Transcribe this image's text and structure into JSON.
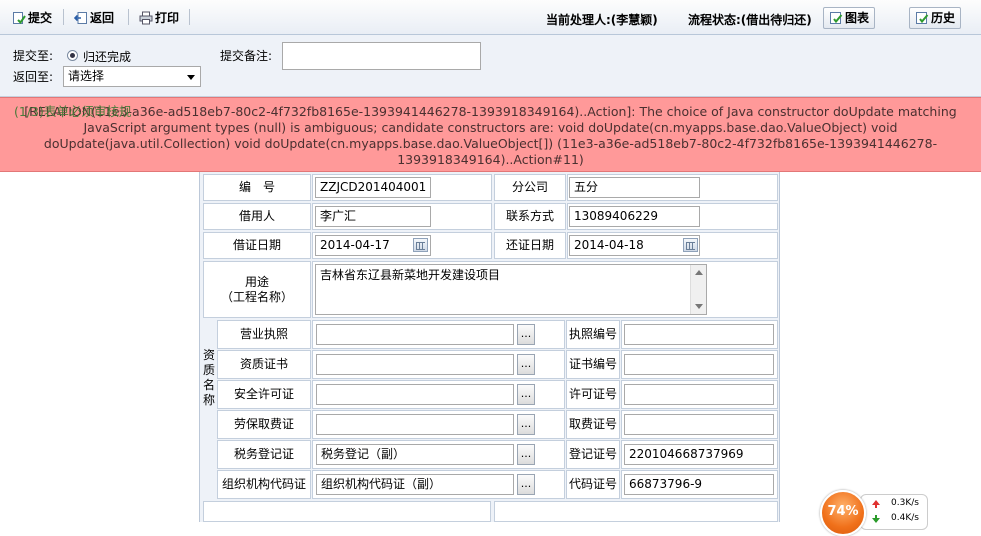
{
  "toolbar": {
    "submit_label": "提交",
    "back_label": "返回",
    "print_label": "打印",
    "handler_text": "当前处理人:(李慧颖)",
    "status_text": "流程状态:(借出待归还)",
    "chart_label": "图表",
    "history_label": "历史"
  },
  "submit_panel": {
    "submit_to_label": "提交至:",
    "radio_option": "归还完成",
    "return_to_label": "返回至:",
    "return_select_value": "请选择",
    "remark_label": "提交备注:",
    "remark_value": ""
  },
  "error": {
    "overlay_text": "(1/3)表单必须审核规",
    "message": "[RELATION(11e3-a36e-ad518eb7-80c2-4f732fb8165e-1393941446278-1393918349164)..Action]: The choice of Java constructor doUpdate matching JavaScript argument types (null) is ambiguous; candidate constructors are: void doUpdate(cn.myapps.base.dao.ValueObject) void doUpdate(java.util.Collection) void doUpdate(cn.myapps.base.dao.ValueObject[]) (11e3-a36e-ad518eb7-80c2-4f732fb8165e-1393941446278-1393918349164)..Action#11)"
  },
  "form": {
    "number_label": "编　号",
    "number_value": "ZZJCD201404001",
    "branch_label": "分公司",
    "branch_value": "五分",
    "borrower_label": "借用人",
    "borrower_value": "李广汇",
    "contact_label": "联系方式",
    "contact_value": "13089406229",
    "borrow_date_label": "借证日期",
    "borrow_date_value": "2014-04-17",
    "return_date_label": "还证日期",
    "return_date_value": "2014-04-18",
    "purpose_label_1": "用途",
    "purpose_label_2": "（工程名称）",
    "purpose_value": "吉林省东辽县新菜地开发建设项目",
    "qual_group_label": "资质名称",
    "dots": "...",
    "rows": [
      {
        "name": "营业执照",
        "value": "",
        "code_label": "执照编号",
        "code_value": ""
      },
      {
        "name": "资质证书",
        "value": "",
        "code_label": "证书编号",
        "code_value": ""
      },
      {
        "name": "安全许可证",
        "value": "",
        "code_label": "许可证号",
        "code_value": ""
      },
      {
        "name": "劳保取费证",
        "value": "",
        "code_label": "取费证号",
        "code_value": ""
      },
      {
        "name": "税务登记证",
        "value": "税务登记（副）",
        "code_label": "登记证号",
        "code_value": "220104668737969"
      },
      {
        "name": "组织机构代码证",
        "value": "组织机构代码证（副）",
        "code_label": "代码证号",
        "code_value": "66873796-9"
      }
    ]
  },
  "speed_widget": {
    "percent": "74%",
    "up": "0.3K/s",
    "down": "0.4K/s"
  },
  "colors": {
    "error_bg": "#ff9999",
    "panel_bg": "#eef2f8",
    "speed_orange": "#f0701a"
  }
}
